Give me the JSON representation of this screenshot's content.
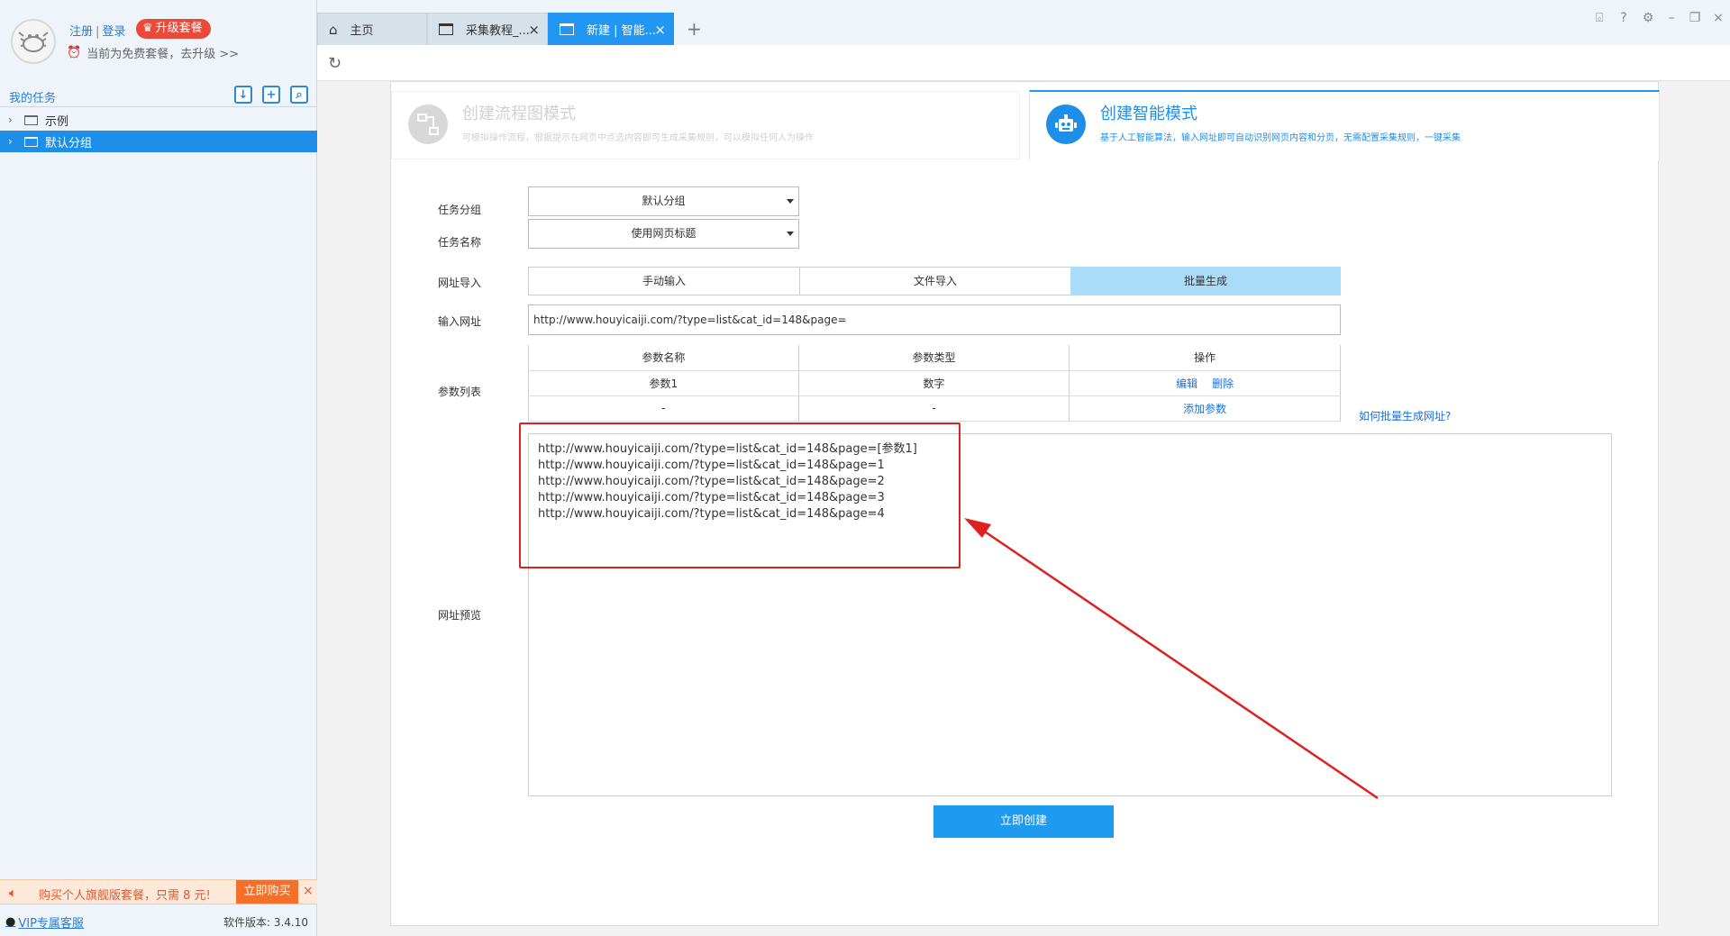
{
  "user": {
    "register_label": "注册",
    "login_label": "登录",
    "upgrade_label": "升级套餐",
    "free_tip": "当前为免费套餐，去升级 >>"
  },
  "sidebar": {
    "title": "我的任务",
    "tree": [
      {
        "label": "示例",
        "selected": false
      },
      {
        "label": "默认分组",
        "selected": true
      }
    ],
    "promo_text": "购买个人旗舰版套餐，只需 8 元!",
    "promo_buy": "立即购买",
    "vip_label": "VIP专属客服",
    "version": "软件版本: 3.4.10"
  },
  "tabs": [
    {
      "label": "主页",
      "icon": "home-icon",
      "active": false
    },
    {
      "label": "采集教程_...",
      "icon": "window-icon",
      "active": false
    },
    {
      "label": "新建 | 智能...",
      "icon": "window-icon",
      "active": true
    }
  ],
  "modes": {
    "flow": {
      "title": "创建流程图模式",
      "desc": "可模拟操作流程，根据提示在网页中点选内容即可生成采集规则，可以模拟任何人为操作"
    },
    "smart": {
      "title": "创建智能模式",
      "desc": "基于人工智能算法，输入网址即可自动识别网页内容和分页，无需配置采集规则，一键采集"
    }
  },
  "form": {
    "group_label": "任务分组",
    "group_value": "默认分组",
    "name_label": "任务名称",
    "name_value": "使用网页标题",
    "import_label": "网址导入",
    "import_options": [
      "手动输入",
      "文件导入",
      "批量生成"
    ],
    "import_selected": "批量生成",
    "url_label": "输入网址",
    "url_value": "http://www.houyicaiji.com/?type=list&cat_id=148&page=",
    "params_label": "参数列表",
    "params_headers": [
      "参数名称",
      "参数类型",
      "操作"
    ],
    "params_rows": [
      {
        "name": "参数1",
        "type": "数字",
        "op1": "编辑",
        "op2": "删除"
      },
      {
        "name": "-",
        "type": "-",
        "op1": "添加参数",
        "op2": ""
      }
    ],
    "help_link": "如何批量生成网址?",
    "preview_label": "网址预览",
    "preview_lines": [
      "http://www.houyicaiji.com/?type=list&cat_id=148&page=[参数1]",
      "http://www.houyicaiji.com/?type=list&cat_id=148&page=1",
      "http://www.houyicaiji.com/?type=list&cat_id=148&page=2",
      "http://www.houyicaiji.com/?type=list&cat_id=148&page=3",
      "http://www.houyicaiji.com/?type=list&cat_id=148&page=4"
    ],
    "create_label": "立即创建"
  },
  "colors": {
    "accent": "#1e8fe8",
    "highlight_red": "#e02020",
    "promo_orange": "#f4702a"
  }
}
